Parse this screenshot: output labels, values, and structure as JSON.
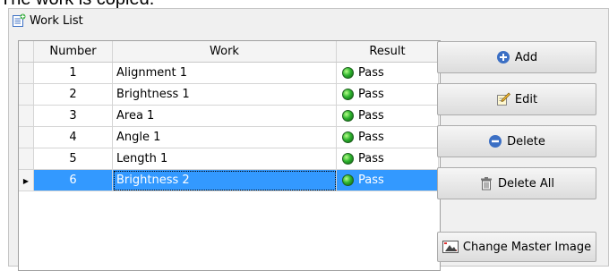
{
  "caption": "The work is copied.",
  "panel": {
    "title": "Work List"
  },
  "table": {
    "columns": [
      "Number",
      "Work",
      "Result"
    ],
    "rows": [
      {
        "number": "1",
        "work": "Alignment 1",
        "result": "Pass"
      },
      {
        "number": "2",
        "work": "Brightness 1",
        "result": "Pass"
      },
      {
        "number": "3",
        "work": "Area 1",
        "result": "Pass"
      },
      {
        "number": "4",
        "work": "Angle 1",
        "result": "Pass"
      },
      {
        "number": "5",
        "work": "Length 1",
        "result": "Pass"
      },
      {
        "number": "6",
        "work": "Brightness 2",
        "result": "Pass",
        "selected": true
      }
    ]
  },
  "buttons": {
    "add": "Add",
    "edit": "Edit",
    "delete": "Delete",
    "delete_all": "Delete All",
    "change_master_image": "Change Master Image"
  },
  "colors": {
    "selection": "#3399ff",
    "pass_led": "#2fb52f",
    "add_icon": "#3b6fc4",
    "delete_icon": "#3b6fc4"
  }
}
